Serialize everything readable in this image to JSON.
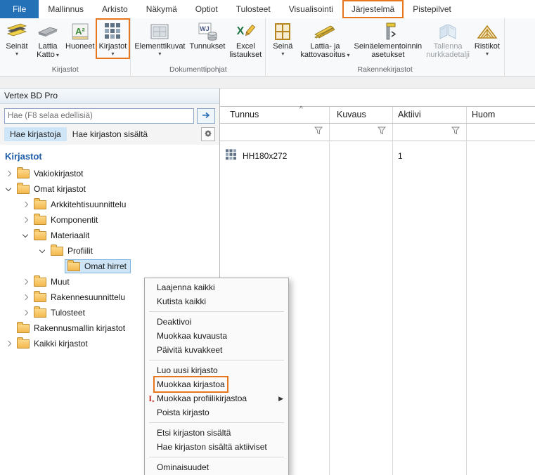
{
  "ribbon": {
    "tabs": [
      {
        "label": "File",
        "active": true
      },
      {
        "label": "Mallinnus"
      },
      {
        "label": "Arkisto"
      },
      {
        "label": "Näkymä"
      },
      {
        "label": "Optiot"
      },
      {
        "label": "Tulosteet"
      },
      {
        "label": "Visualisointi"
      },
      {
        "label": "Järjestelmä",
        "annotated": true
      },
      {
        "label": "Pistepilvet"
      }
    ],
    "groups": [
      {
        "label": "Kirjastot",
        "buttons": [
          {
            "lines": [
              "Seinät"
            ],
            "dropdown": true,
            "icon": "wall-layers-icon"
          },
          {
            "lines": [
              "Lattia",
              "Katto"
            ],
            "dropdown": true,
            "icon": "floor-ceiling-icon"
          },
          {
            "lines": [
              "Huoneet"
            ],
            "icon": "rooms-a2-icon"
          },
          {
            "lines": [
              "Kirjastot"
            ],
            "dropdown": true,
            "icon": "libraries-grid-icon",
            "annotated": true
          }
        ]
      },
      {
        "label": "Dokumenttipohjat",
        "buttons": [
          {
            "lines": [
              "Elementtikuvat"
            ],
            "dropdown": true,
            "icon": "element-drawings-icon"
          },
          {
            "lines": [
              "Tunnukset"
            ],
            "icon": "tokens-icon"
          },
          {
            "lines": [
              "Excel",
              "listaukset"
            ],
            "icon": "excel-lists-icon"
          }
        ]
      },
      {
        "label": "Rakennekirjastot",
        "buttons": [
          {
            "lines": [
              "Seinä"
            ],
            "dropdown": true,
            "icon": "wall-frame-icon"
          },
          {
            "lines": [
              "Lattia- ja",
              "kattovasoitus"
            ],
            "dropdown": true,
            "icon": "floor-joists-icon"
          },
          {
            "lines": [
              "Seinäelementoinnin",
              "asetukset"
            ],
            "icon": "wall-element-settings-icon"
          },
          {
            "lines": [
              "Tallenna",
              "nurkkadetalji"
            ],
            "disabled": true,
            "icon": "save-corner-detail-icon"
          },
          {
            "lines": [
              "Ristikot"
            ],
            "dropdown": true,
            "icon": "trusses-icon"
          }
        ]
      }
    ]
  },
  "panel": {
    "title": "Vertex BD Pro",
    "search": {
      "placeholder": "Hae (F8 selaa edellisiä)"
    },
    "tabs": [
      {
        "label": "Hae kirjastoja",
        "active": true
      },
      {
        "label": "Hae kirjaston sisältä",
        "active": false
      }
    ],
    "tree": {
      "heading": "Kirjastot",
      "items": [
        {
          "label": "Vakiokirjastot",
          "level": 1,
          "expand": "collapsed"
        },
        {
          "label": "Omat kirjastot",
          "level": 1,
          "expand": "expanded"
        },
        {
          "label": "Arkkitehtisuunnittelu",
          "level": 2,
          "expand": "collapsed"
        },
        {
          "label": "Komponentit",
          "level": 2,
          "expand": "collapsed"
        },
        {
          "label": "Materiaalit",
          "level": 2,
          "expand": "expanded"
        },
        {
          "label": "Profiilit",
          "level": 3,
          "expand": "expanded"
        },
        {
          "label": "Omat hirret",
          "level": 4,
          "expand": "none",
          "selected": true
        },
        {
          "label": "Muut",
          "level": 2,
          "expand": "collapsed"
        },
        {
          "label": "Rakennesuunnittelu",
          "level": 2,
          "expand": "collapsed"
        },
        {
          "label": "Tulosteet",
          "level": 2,
          "expand": "collapsed"
        },
        {
          "label": "Rakennusmallin kirjastot",
          "level": 1,
          "expand": "none"
        },
        {
          "label": "Kaikki kirjastot",
          "level": 1,
          "expand": "collapsed"
        }
      ]
    }
  },
  "table": {
    "columns": [
      {
        "label": "Tunnus",
        "sorted": "ascending",
        "filter": true
      },
      {
        "label": "Kuvaus",
        "filter": true
      },
      {
        "label": "Aktiivi",
        "filter": true
      },
      {
        "label": "Huom",
        "filter": false
      }
    ],
    "rows": [
      {
        "tunnus": "HH180x272",
        "kuvaus": "",
        "aktiivi": "1",
        "huom": ""
      }
    ]
  },
  "context_menu": {
    "items": [
      {
        "label": "Laajenna kaikki"
      },
      {
        "label": "Kutista kaikki"
      },
      {
        "separator": true
      },
      {
        "label": "Deaktivoi"
      },
      {
        "label": "Muokkaa kuvausta"
      },
      {
        "label": "Päivitä kuvakkeet"
      },
      {
        "separator": true
      },
      {
        "label": "Luo uusi kirjasto"
      },
      {
        "label": "Muokkaa kirjastoa",
        "annotated": true
      },
      {
        "label": "Muokkaa profiilikirjastoa",
        "icon": "profile-library-icon",
        "submenu": true
      },
      {
        "label": "Poista kirjasto"
      },
      {
        "separator": true
      },
      {
        "label": "Etsi kirjaston sisältä"
      },
      {
        "label": "Hae kirjaston sisältä aktiiviset"
      },
      {
        "separator": true
      },
      {
        "label": "Ominaisuudet"
      }
    ]
  },
  "colors": {
    "file_tab_blue": "#2471b8",
    "annotation_orange": "#e8761d",
    "selection_blue": "#cde5f7",
    "heading_blue": "#1f5da8",
    "folder_yellow": "#f3b74d"
  }
}
